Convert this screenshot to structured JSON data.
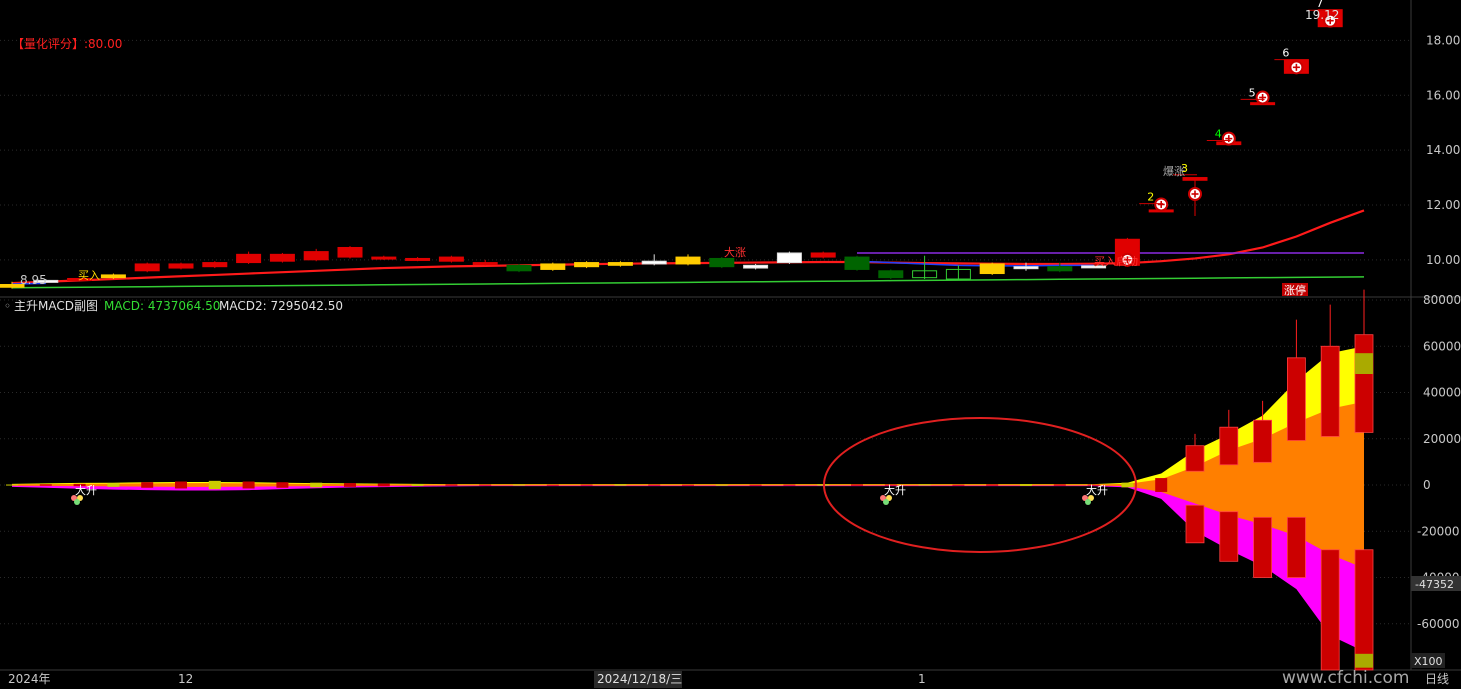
{
  "colors": {
    "background": "#000000",
    "axis_text": "#c8c8c8",
    "grid": "#2a2a2a",
    "divider": "#3a3a3a",
    "up_candle": "#e00000",
    "down_candle": "#006400",
    "ma_red": "#ff1a1a",
    "ma_blue": "#1e40ff",
    "ma_green": "#33cc33",
    "purple_line": "#8a2be2",
    "macd_yellow": "#ffff00",
    "macd_orange": "#ff7f00",
    "macd_magenta": "#ff00ff",
    "annotation_ellipse": "#e02020",
    "score_text": "#ff2020",
    "watermark": "#d0d0d0"
  },
  "top_panel": {
    "score_label": "【量化评分】:80.00",
    "min_price_label": "8.95",
    "max_price_label": "19.12",
    "limit_up_badge": "涨停",
    "signal_labels": [
      "买入",
      "大涨",
      "爆涨",
      "买入启动"
    ],
    "wave_numbers": [
      "2",
      "3",
      "4",
      "5",
      "6",
      "7"
    ],
    "wave_number_colors": [
      "#ffff00",
      "#ffff00",
      "#00ff00",
      "#ffffff",
      "#ffffff",
      "#ffffff"
    ]
  },
  "bottom_panel": {
    "indicator_name": "主升MACD副图",
    "macd_label": "MACD: 4737064.50",
    "macd2_label": "MACD2: 7295042.50",
    "signal_labels": [
      "大升",
      "大升",
      "大升"
    ],
    "cursor_value": "-47352",
    "scale_badge": "X100"
  },
  "x_axis": {
    "labels": [
      "2024年",
      "12",
      "2024/12/18/三",
      "1"
    ],
    "period": "日线"
  },
  "watermark": "www.cfchi.com",
  "chart_data": [
    {
      "type": "candlestick",
      "title": "",
      "y_ticks": [
        10,
        12,
        14,
        16,
        18
      ],
      "ylim": [
        8.9,
        19.4
      ],
      "grid": true,
      "candles": [
        {
          "o": 9.1,
          "h": 9.2,
          "l": 8.95,
          "c": 9.0,
          "color": "yellow"
        },
        {
          "o": 9.2,
          "h": 9.3,
          "l": 9.15,
          "c": 9.25,
          "color": "white"
        },
        {
          "o": 9.3,
          "h": 9.35,
          "l": 9.25,
          "c": 9.32,
          "color": "red"
        },
        {
          "o": 9.35,
          "h": 9.5,
          "l": 9.3,
          "c": 9.45,
          "color": "yellow"
        },
        {
          "o": 9.6,
          "h": 9.9,
          "l": 9.55,
          "c": 9.85,
          "color": "red"
        },
        {
          "o": 9.7,
          "h": 9.9,
          "l": 9.65,
          "c": 9.85,
          "color": "red"
        },
        {
          "o": 9.75,
          "h": 9.95,
          "l": 9.7,
          "c": 9.9,
          "color": "red"
        },
        {
          "o": 9.9,
          "h": 10.3,
          "l": 9.85,
          "c": 10.2,
          "color": "red"
        },
        {
          "o": 9.95,
          "h": 10.25,
          "l": 9.9,
          "c": 10.2,
          "color": "red"
        },
        {
          "o": 10.0,
          "h": 10.4,
          "l": 9.95,
          "c": 10.3,
          "color": "red"
        },
        {
          "o": 10.1,
          "h": 10.5,
          "l": 10.05,
          "c": 10.45,
          "color": "red"
        },
        {
          "o": 10.05,
          "h": 10.15,
          "l": 10.0,
          "c": 10.1,
          "color": "red"
        },
        {
          "o": 10.0,
          "h": 10.1,
          "l": 9.95,
          "c": 10.05,
          "color": "red"
        },
        {
          "o": 9.95,
          "h": 10.15,
          "l": 9.9,
          "c": 10.1,
          "color": "red"
        },
        {
          "o": 9.85,
          "h": 10.0,
          "l": 9.8,
          "c": 9.9,
          "color": "red"
        },
        {
          "o": 9.8,
          "h": 9.85,
          "l": 9.55,
          "c": 9.6,
          "color": "green"
        },
        {
          "o": 9.65,
          "h": 9.9,
          "l": 9.6,
          "c": 9.85,
          "color": "yellow"
        },
        {
          "o": 9.75,
          "h": 9.95,
          "l": 9.7,
          "c": 9.9,
          "color": "yellow"
        },
        {
          "o": 9.8,
          "h": 9.95,
          "l": 9.75,
          "c": 9.9,
          "color": "yellow"
        },
        {
          "o": 9.85,
          "h": 10.2,
          "l": 9.8,
          "c": 9.95,
          "color": "white"
        },
        {
          "o": 9.85,
          "h": 10.2,
          "l": 9.8,
          "c": 10.1,
          "color": "yellow"
        },
        {
          "o": 10.05,
          "h": 10.1,
          "l": 9.7,
          "c": 9.75,
          "color": "green"
        },
        {
          "o": 9.7,
          "h": 9.85,
          "l": 9.65,
          "c": 9.8,
          "color": "white"
        },
        {
          "o": 9.9,
          "h": 10.3,
          "l": 9.85,
          "c": 10.25,
          "color": "white"
        },
        {
          "o": 10.1,
          "h": 10.3,
          "l": 10.05,
          "c": 10.25,
          "color": "red"
        },
        {
          "o": 10.1,
          "h": 10.15,
          "l": 9.6,
          "c": 9.65,
          "color": "green"
        },
        {
          "o": 9.6,
          "h": 9.65,
          "l": 9.3,
          "c": 9.35,
          "color": "green"
        },
        {
          "o": 9.35,
          "h": 10.15,
          "l": 9.3,
          "c": 9.6,
          "color": "hollow_green"
        },
        {
          "o": 9.3,
          "h": 9.8,
          "l": 9.25,
          "c": 9.65,
          "color": "hollow_green"
        },
        {
          "o": 9.5,
          "h": 9.9,
          "l": 9.45,
          "c": 9.85,
          "color": "yellow"
        },
        {
          "o": 9.7,
          "h": 9.9,
          "l": 9.6,
          "c": 9.75,
          "color": "white"
        },
        {
          "o": 9.6,
          "h": 9.9,
          "l": 9.55,
          "c": 9.75,
          "color": "green"
        },
        {
          "o": 9.75,
          "h": 9.8,
          "l": 9.7,
          "c": 9.78,
          "color": "white"
        },
        {
          "o": 9.8,
          "h": 10.8,
          "l": 9.75,
          "c": 10.75,
          "color": "red"
        },
        {
          "o": 11.8,
          "h": 11.85,
          "l": 11.8,
          "c": 11.82,
          "color": "red"
        },
        {
          "o": 12.9,
          "h": 13.0,
          "l": 11.6,
          "c": 13.0,
          "color": "red"
        },
        {
          "o": 14.2,
          "h": 14.3,
          "l": 14.2,
          "c": 14.3,
          "color": "red"
        },
        {
          "o": 15.7,
          "h": 15.75,
          "l": 15.7,
          "c": 15.73,
          "color": "red"
        },
        {
          "o": 16.8,
          "h": 17.3,
          "l": 16.8,
          "c": 17.3,
          "color": "red"
        },
        {
          "o": 18.5,
          "h": 19.12,
          "l": 18.5,
          "c": 19.12,
          "color": "red"
        }
      ],
      "series": [
        {
          "name": "",
          "color": "#ff1a1a",
          "values": [
            9.15,
            9.2,
            9.25,
            9.3,
            9.35,
            9.4,
            9.45,
            9.5,
            9.55,
            9.6,
            9.65,
            9.7,
            9.73,
            9.76,
            9.78,
            9.8,
            9.82,
            9.84,
            9.86,
            9.87,
            9.88,
            9.89,
            9.9,
            9.91,
            9.92,
            9.92,
            9.9,
            9.88,
            9.87,
            9.86,
            9.85,
            9.85,
            9.86,
            9.88,
            9.95,
            10.05,
            10.2,
            10.45,
            10.85,
            11.35,
            11.8
          ]
        },
        {
          "name": "",
          "color": "#1e40ff",
          "values": [
            9.12,
            9.14,
            null,
            null,
            null,
            null,
            null,
            null,
            null,
            null,
            null,
            null,
            null,
            null,
            null,
            null,
            null,
            null,
            null,
            null,
            null,
            null,
            null,
            null,
            null,
            9.95,
            9.9,
            9.85,
            9.8,
            9.78,
            9.78,
            9.8,
            9.8
          ]
        },
        {
          "name": "",
          "color": "#33cc33",
          "values": [
            8.98,
            8.99,
            9.0,
            9.01,
            9.02,
            9.03,
            9.04,
            9.05,
            9.06,
            9.07,
            9.08,
            9.09,
            9.1,
            9.11,
            9.12,
            9.13,
            9.14,
            9.15,
            9.16,
            9.17,
            9.18,
            9.19,
            9.2,
            9.21,
            9.22,
            9.23,
            9.24,
            9.25,
            9.26,
            9.27,
            9.28,
            9.29,
            9.3,
            9.31,
            9.32,
            9.33,
            9.34,
            9.35,
            9.36,
            9.37,
            9.38
          ]
        },
        {
          "name": "",
          "color": "#8a2be2",
          "values": [
            null,
            null,
            null,
            null,
            null,
            null,
            null,
            null,
            null,
            null,
            null,
            null,
            null,
            null,
            null,
            null,
            null,
            null,
            null,
            null,
            null,
            null,
            null,
            null,
            null,
            10.25,
            10.25,
            10.25,
            10.25,
            10.25,
            10.25,
            10.25,
            10.25,
            10.25,
            10.25,
            10.25,
            10.25,
            10.25,
            10.25,
            10.25,
            10.25
          ]
        }
      ]
    },
    {
      "type": "bar",
      "title": "",
      "y_ticks": [
        80000,
        60000,
        40000,
        20000,
        0,
        -20000,
        -40000,
        -60000
      ],
      "ylim": [
        -80000,
        80000
      ],
      "grid": true,
      "bars_upper": [
        200,
        300,
        500,
        800,
        1200,
        1500,
        1800,
        1500,
        1200,
        1000,
        800,
        600,
        400,
        300,
        200,
        150,
        150,
        200,
        300,
        200,
        150,
        100,
        150,
        200,
        250,
        300,
        250,
        200,
        150,
        300,
        400,
        300,
        200,
        1000,
        3000,
        17000,
        25000,
        28000,
        55000,
        60000,
        65000
      ],
      "bars_lower": [
        -200,
        -300,
        -500,
        -800,
        -1200,
        -1500,
        -1800,
        -1500,
        -1200,
        -1000,
        -800,
        -600,
        -400,
        -300,
        -200,
        -150,
        -150,
        -200,
        -300,
        -200,
        -150,
        -100,
        -150,
        -200,
        -250,
        -300,
        -250,
        -200,
        -150,
        -300,
        -400,
        -300,
        -200,
        -1000,
        -3000,
        -25000,
        -33000,
        -40000,
        -40000,
        -80000,
        -80000
      ],
      "band_yellow_upper": [
        500,
        700,
        900,
        1000,
        1200,
        1300,
        1300,
        1200,
        1000,
        800,
        700,
        600,
        500,
        400,
        400,
        400,
        400,
        400,
        400,
        400,
        400,
        400,
        400,
        400,
        400,
        400,
        400,
        400,
        400,
        400,
        400,
        400,
        400,
        1000,
        5000,
        15000,
        22000,
        30000,
        45000,
        57000,
        60000
      ],
      "band_orange_upper": [
        300,
        400,
        500,
        600,
        700,
        800,
        800,
        700,
        600,
        500,
        400,
        350,
        300,
        250,
        250,
        250,
        250,
        250,
        250,
        250,
        250,
        250,
        250,
        250,
        250,
        250,
        250,
        250,
        250,
        250,
        250,
        250,
        250,
        500,
        2500,
        8000,
        15000,
        20000,
        27000,
        33000,
        36000
      ],
      "band_orange_lower": [
        -300,
        -400,
        -500,
        -600,
        -700,
        -800,
        -800,
        -700,
        -600,
        -500,
        -400,
        -350,
        -300,
        -250,
        -250,
        -250,
        -250,
        -250,
        -250,
        -250,
        -250,
        -250,
        -250,
        -250,
        -250,
        -250,
        -250,
        -250,
        -250,
        -250,
        -250,
        -250,
        -250,
        -500,
        -3000,
        -8000,
        -13000,
        -17000,
        -22000,
        -30000,
        -36000
      ],
      "band_magenta_lower": [
        -800,
        -1200,
        -1600,
        -2000,
        -2200,
        -2400,
        -2400,
        -2200,
        -1800,
        -1400,
        -1100,
        -900,
        -700,
        -600,
        -500,
        -500,
        -500,
        -500,
        -500,
        -500,
        -500,
        -500,
        -500,
        -500,
        -500,
        -500,
        -500,
        -500,
        -500,
        -500,
        -500,
        -500,
        -500,
        -1000,
        -6000,
        -20000,
        -28000,
        -35000,
        -45000,
        -65000,
        -72000
      ]
    }
  ]
}
